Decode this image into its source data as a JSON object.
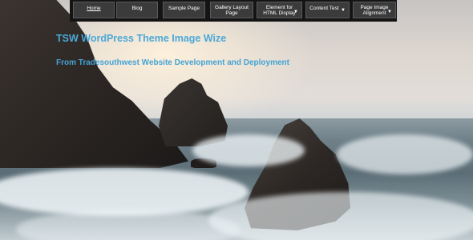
{
  "nav": {
    "items": [
      {
        "label": "Home",
        "active": true
      },
      {
        "label": "Blog"
      },
      {
        "label": "Sample Page"
      },
      {
        "label": "Gallery Layout Page"
      },
      {
        "label": "Element for HTML Display",
        "dropdown": true
      },
      {
        "label": "Content Test",
        "dropdown": true
      },
      {
        "label": "Page Image Alignment",
        "dropdown": true
      }
    ]
  },
  "hero": {
    "title": "TSW WordPress Theme Image Wize",
    "tagline": "From Tradesouthwest Website Development and Deployment"
  },
  "colors": {
    "title": "#4aa8d8",
    "nav_background": "#141414",
    "nav_button": "#3b3b3b"
  },
  "icons": {
    "dropdown": "caret-down-icon"
  }
}
